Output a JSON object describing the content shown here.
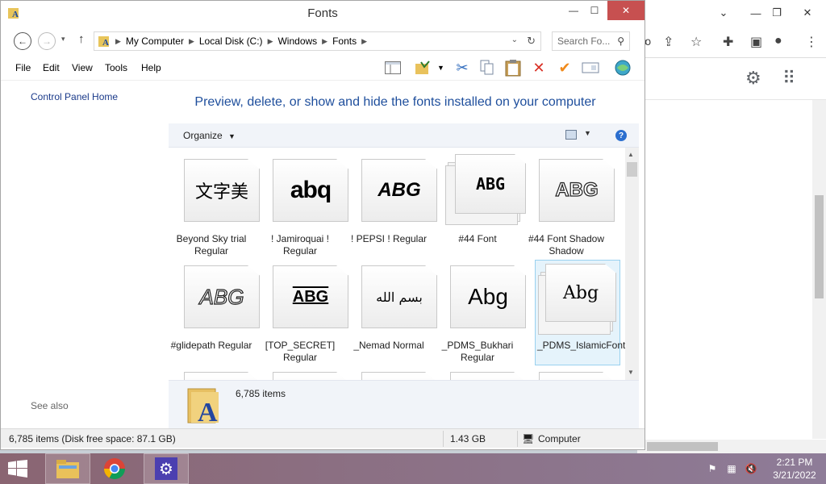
{
  "window": {
    "title": "Fonts"
  },
  "address": {
    "segments": [
      "My Computer",
      "Local Disk (C:)",
      "Windows",
      "Fonts"
    ],
    "search_placeholder": "Search Fo..."
  },
  "menu": [
    "File",
    "Edit",
    "View",
    "Tools",
    "Help"
  ],
  "navpane": {
    "home_link": "Control Panel Home",
    "see_also": "See also"
  },
  "headline": "Preview, delete, or show and hide the fonts installed on your computer",
  "commandbar": {
    "organize": "Organize",
    "dropdown_arrow": "▾"
  },
  "fonts": [
    {
      "label": "Beyond Sky trial Regular",
      "preview": "文字美",
      "stacked": false,
      "selected": false
    },
    {
      "label": "! Jamiroquai ! Regular",
      "preview": "abq",
      "stacked": false,
      "selected": false
    },
    {
      "label": "! PEPSI ! Regular",
      "preview": "ABG",
      "stacked": false,
      "selected": false
    },
    {
      "label": "#44 Font",
      "preview": "ABG",
      "stacked": true,
      "selected": false
    },
    {
      "label": "#44 Font Shadow Shadow",
      "preview": "ABG",
      "stacked": false,
      "selected": false
    },
    {
      "label": "#glidepath Regular",
      "preview": "ABG",
      "stacked": false,
      "selected": false
    },
    {
      "label": "[TOP_SECRET] Regular",
      "preview": "ABG",
      "stacked": false,
      "selected": false
    },
    {
      "label": "_Nemad Normal",
      "preview": "بسم الله",
      "stacked": false,
      "selected": false
    },
    {
      "label": "_PDMS_Bukhari Regular",
      "preview": "Abg",
      "stacked": false,
      "selected": false
    },
    {
      "label": "_PDMS_IslamicFont",
      "preview": "Abg",
      "stacked": true,
      "selected": true
    }
  ],
  "details": {
    "count": "6,785 items"
  },
  "status": {
    "items": "6,785 items (Disk free space: 87.1 GB)",
    "size": "1.43 GB",
    "location": "Computer"
  },
  "taskbar": {
    "time": "2:21 PM",
    "date": "3/21/2022"
  },
  "colors": {
    "link": "#1e4e9c",
    "close": "#c75050",
    "selection": "#e5f3fb"
  }
}
